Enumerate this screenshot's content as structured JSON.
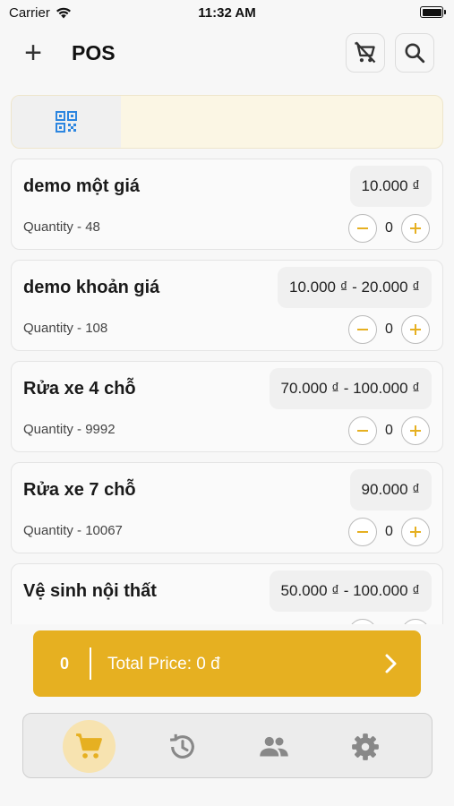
{
  "status_bar": {
    "carrier": "Carrier",
    "time": "11:32 AM"
  },
  "header": {
    "title": "POS",
    "add_icon": "+"
  },
  "products": [
    {
      "name": "demo một giá",
      "price": "10.000 ₫",
      "quantity_label": "Quantity - 48",
      "count": "0"
    },
    {
      "name": "demo khoản giá",
      "price": "10.000 ₫ - 20.000 ₫",
      "quantity_label": "Quantity - 108",
      "count": "0"
    },
    {
      "name": "Rửa xe 4 chỗ",
      "price": "70.000 ₫ - 100.000 ₫",
      "quantity_label": "Quantity - 9992",
      "count": "0"
    },
    {
      "name": "Rửa xe 7 chỗ",
      "price": "90.000 ₫",
      "quantity_label": "Quantity - 10067",
      "count": "0"
    },
    {
      "name": "Vệ sinh nội thất",
      "price": "50.000 ₫ - 100.000 ₫",
      "quantity_label": "",
      "count": ""
    }
  ],
  "total_bar": {
    "count": "0",
    "label": "Total Price: 0 đ"
  },
  "colors": {
    "accent": "#e6b021",
    "accent_light": "#f7e3b0",
    "qr_blue": "#2d86e0",
    "nav_icon": "#888888"
  },
  "icons": {
    "cart_off": "remove-shopping-cart-icon",
    "search": "search-icon",
    "qr": "qr-code-icon",
    "minus": "minus-circle-icon",
    "plus": "plus-circle-icon",
    "next": "chevron-right-icon",
    "nav": [
      "shopping-cart-icon",
      "history-icon",
      "people-icon",
      "settings-icon"
    ]
  }
}
